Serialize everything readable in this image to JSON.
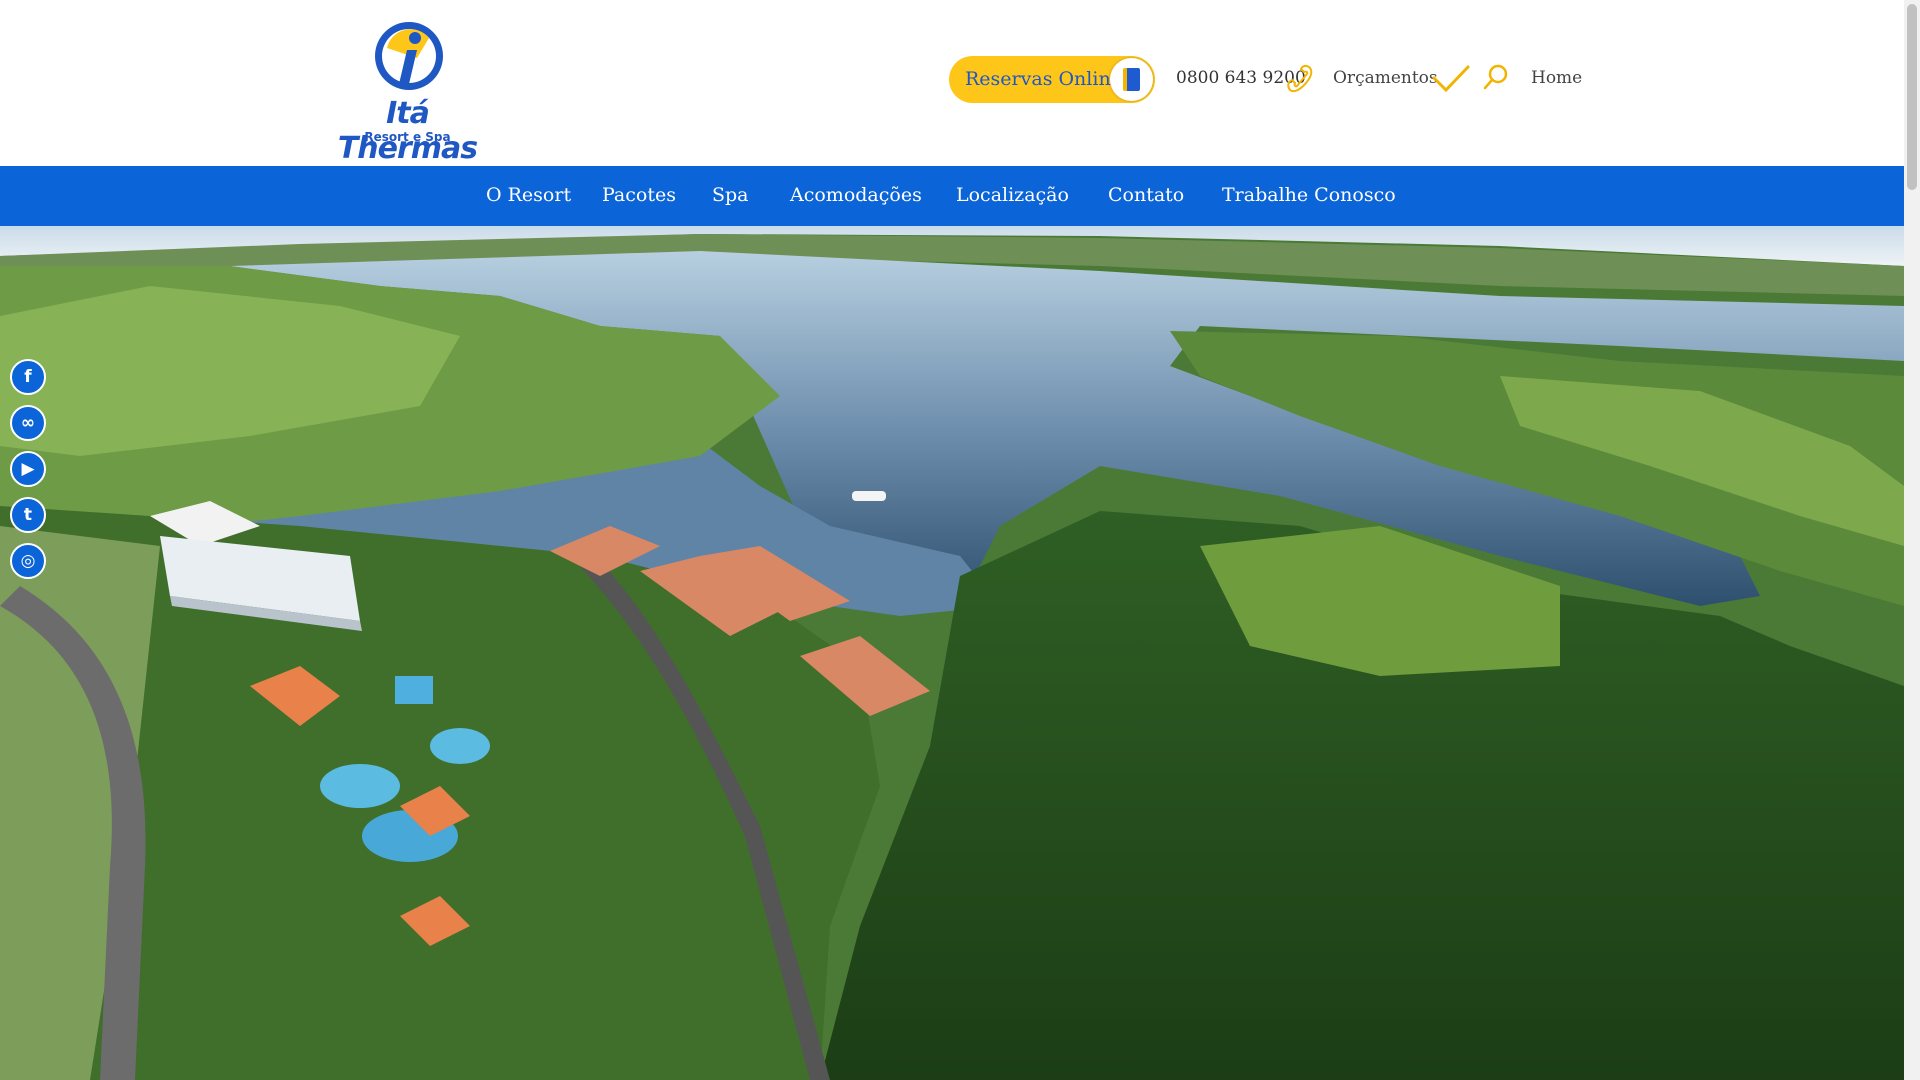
{
  "brand": {
    "name": "Itá Thermas",
    "subtitle": "Resort e Spa"
  },
  "header": {
    "reservas_label": "Reservas Online",
    "phone": "0800 643 9200",
    "orcamentos": "Orçamentos",
    "home": "Home"
  },
  "nav": {
    "items": [
      {
        "label": "O Resort"
      },
      {
        "label": "Pacotes"
      },
      {
        "label": "Spa"
      },
      {
        "label": "Acomodações"
      },
      {
        "label": "Localização"
      },
      {
        "label": "Contato"
      },
      {
        "label": "Trabalhe Conosco"
      }
    ]
  },
  "social": {
    "items": [
      {
        "icon": "facebook-icon",
        "glyph": "f"
      },
      {
        "icon": "tripadvisor-icon",
        "glyph": "∞"
      },
      {
        "icon": "youtube-icon",
        "glyph": "▶"
      },
      {
        "icon": "twitter-icon",
        "glyph": "t"
      },
      {
        "icon": "instagram-icon",
        "glyph": "◎"
      }
    ]
  },
  "colors": {
    "brand_blue": "#0c64d9",
    "accent_yellow": "#ffc61a"
  }
}
